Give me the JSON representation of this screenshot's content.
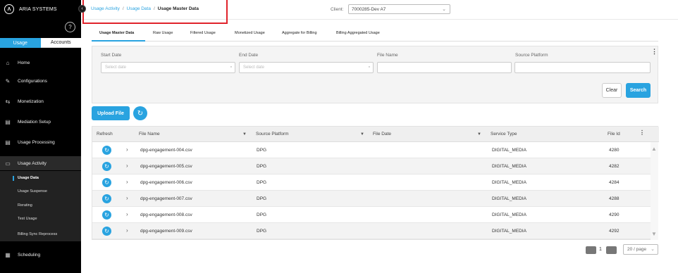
{
  "sidebar": {
    "brand": "ARIA SYSTEMS",
    "logo_glyph": "Λ",
    "toggle": {
      "usage": "Usage",
      "accounts": "Accounts"
    },
    "nav": [
      {
        "label": "Home",
        "icon": "home-icon"
      },
      {
        "label": "Configurations",
        "icon": "wrench-icon"
      },
      {
        "label": "Monetization",
        "icon": "arrows-icon"
      },
      {
        "label": "Mediation Setup",
        "icon": "document-icon"
      },
      {
        "label": "Usage Processing",
        "icon": "document-icon"
      },
      {
        "label": "Usage Activity",
        "icon": "folder-icon"
      },
      {
        "label": "Scheduling",
        "icon": "calendar-icon"
      }
    ],
    "sub": [
      "Usage Data",
      "Usage Suspense",
      "Rerating",
      "Test Usage",
      "Billing Sync Reprocess"
    ]
  },
  "header": {
    "breadcrumbs": [
      "Usage Activity",
      "Usage Data",
      "Usage Master Data"
    ],
    "client_label": "Client:",
    "client_value": "7000285-Dev A7"
  },
  "tabs": [
    "Usage Master Data",
    "Raw Usage",
    "Filtered Usage",
    "Monetized Usage",
    "Aggregate for Billing",
    "Billing Aggregated Usage"
  ],
  "filters": {
    "start_date": {
      "label": "Start Date",
      "placeholder": "Select date"
    },
    "end_date": {
      "label": "End Date",
      "placeholder": "Select date"
    },
    "file_name": {
      "label": "File Name",
      "placeholder": ""
    },
    "source_platform": {
      "label": "Source Platform",
      "placeholder": ""
    },
    "clear": "Clear",
    "search": "Search"
  },
  "upload_label": "Upload File",
  "table": {
    "columns": [
      "Refresh",
      "File Name",
      "Source Platform",
      "File Date",
      "Service Type",
      "File Id"
    ],
    "rows": [
      {
        "file_name": "dpg-engagement-004.csv",
        "source": "DPG",
        "file_date": "",
        "service": "DIGITAL_MEDIA",
        "file_id": "4280"
      },
      {
        "file_name": "dpg-engagement-005.csv",
        "source": "DPG",
        "file_date": "",
        "service": "DIGITAL_MEDIA",
        "file_id": "4282"
      },
      {
        "file_name": "dpg-engagement-006.csv",
        "source": "DPG",
        "file_date": "",
        "service": "DIGITAL_MEDIA",
        "file_id": "4284"
      },
      {
        "file_name": "dpg-engagement-007.csv",
        "source": "DPG",
        "file_date": "",
        "service": "DIGITAL_MEDIA",
        "file_id": "4288"
      },
      {
        "file_name": "dpg-engagement-008.csv",
        "source": "DPG",
        "file_date": "",
        "service": "DIGITAL_MEDIA",
        "file_id": "4290"
      },
      {
        "file_name": "dpg-engagement-009.csv",
        "source": "DPG",
        "file_date": "",
        "service": "DIGITAL_MEDIA",
        "file_id": "4292"
      }
    ]
  },
  "pagination": {
    "page": "1",
    "page_size": "20 / page"
  },
  "colors": {
    "accent": "#29a3e0",
    "highlight_box": "#e0232b",
    "sidebar_bg": "#000000"
  }
}
